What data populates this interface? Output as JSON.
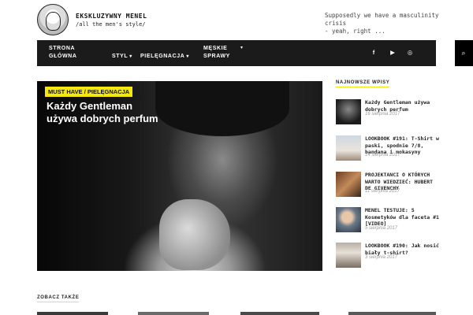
{
  "header": {
    "site_title": "EKSKLUZYWNY MENEL",
    "tagline": "/all the men's style/",
    "quote_lines": [
      "Supposedly we have a masculinity",
      "crisis",
      "- yeah, right ..."
    ]
  },
  "nav": {
    "items": [
      {
        "line1": "STRONA",
        "line2": "GŁÓWNA"
      },
      {
        "line1": "STYL",
        "caret": "▾"
      },
      {
        "line1": "PIELĘGNACJA",
        "caret": "▾"
      },
      {
        "line1": "MĘSKIE",
        "line2": "SPRAWY",
        "caret": "▾"
      }
    ],
    "icons": [
      "facebook-icon",
      "youtube-icon",
      "instagram-icon",
      "search-icon"
    ],
    "icon_glyphs": {
      "facebook": "f",
      "youtube": "▶",
      "instagram": "◎",
      "search": "⌕"
    }
  },
  "hero": {
    "category": "MUST HAVE / PIELĘGNACJA",
    "title_line1": "Każdy Gentleman",
    "title_line2": "używa dobrych perfum"
  },
  "sidebar": {
    "title": "NAJNOWSZE WPISY",
    "posts": [
      {
        "title": "Każdy Gentleman używa dobrych perfum",
        "date": "16 sierpnia 2017"
      },
      {
        "title": "LOOKBOOK #191: T-Shirt w paski, spodnie 7/8, bandana i mokasyny",
        "date": "14 sierpnia 2017"
      },
      {
        "title": "PROJEKTANCI O KTÓRYCH WARTO WIEDZIEĆ: HUBERT DE GIVENCHY",
        "date": "11 sierpnia 2017"
      },
      {
        "title": "MENEL TESTUJE: 5 Kosmetyków dla faceta #1 [VIDEO]",
        "date": "5 sierpnia 2017"
      },
      {
        "title": "LOOKBOOK #190: Jak nosić biały t-shirt?",
        "date": "3 sierpnia 2017"
      }
    ]
  },
  "section": {
    "see_also": "ZOBACZ TAKŻE"
  },
  "colors": {
    "accent": "#f5e80c",
    "nav_bg": "#1b1b1b"
  }
}
